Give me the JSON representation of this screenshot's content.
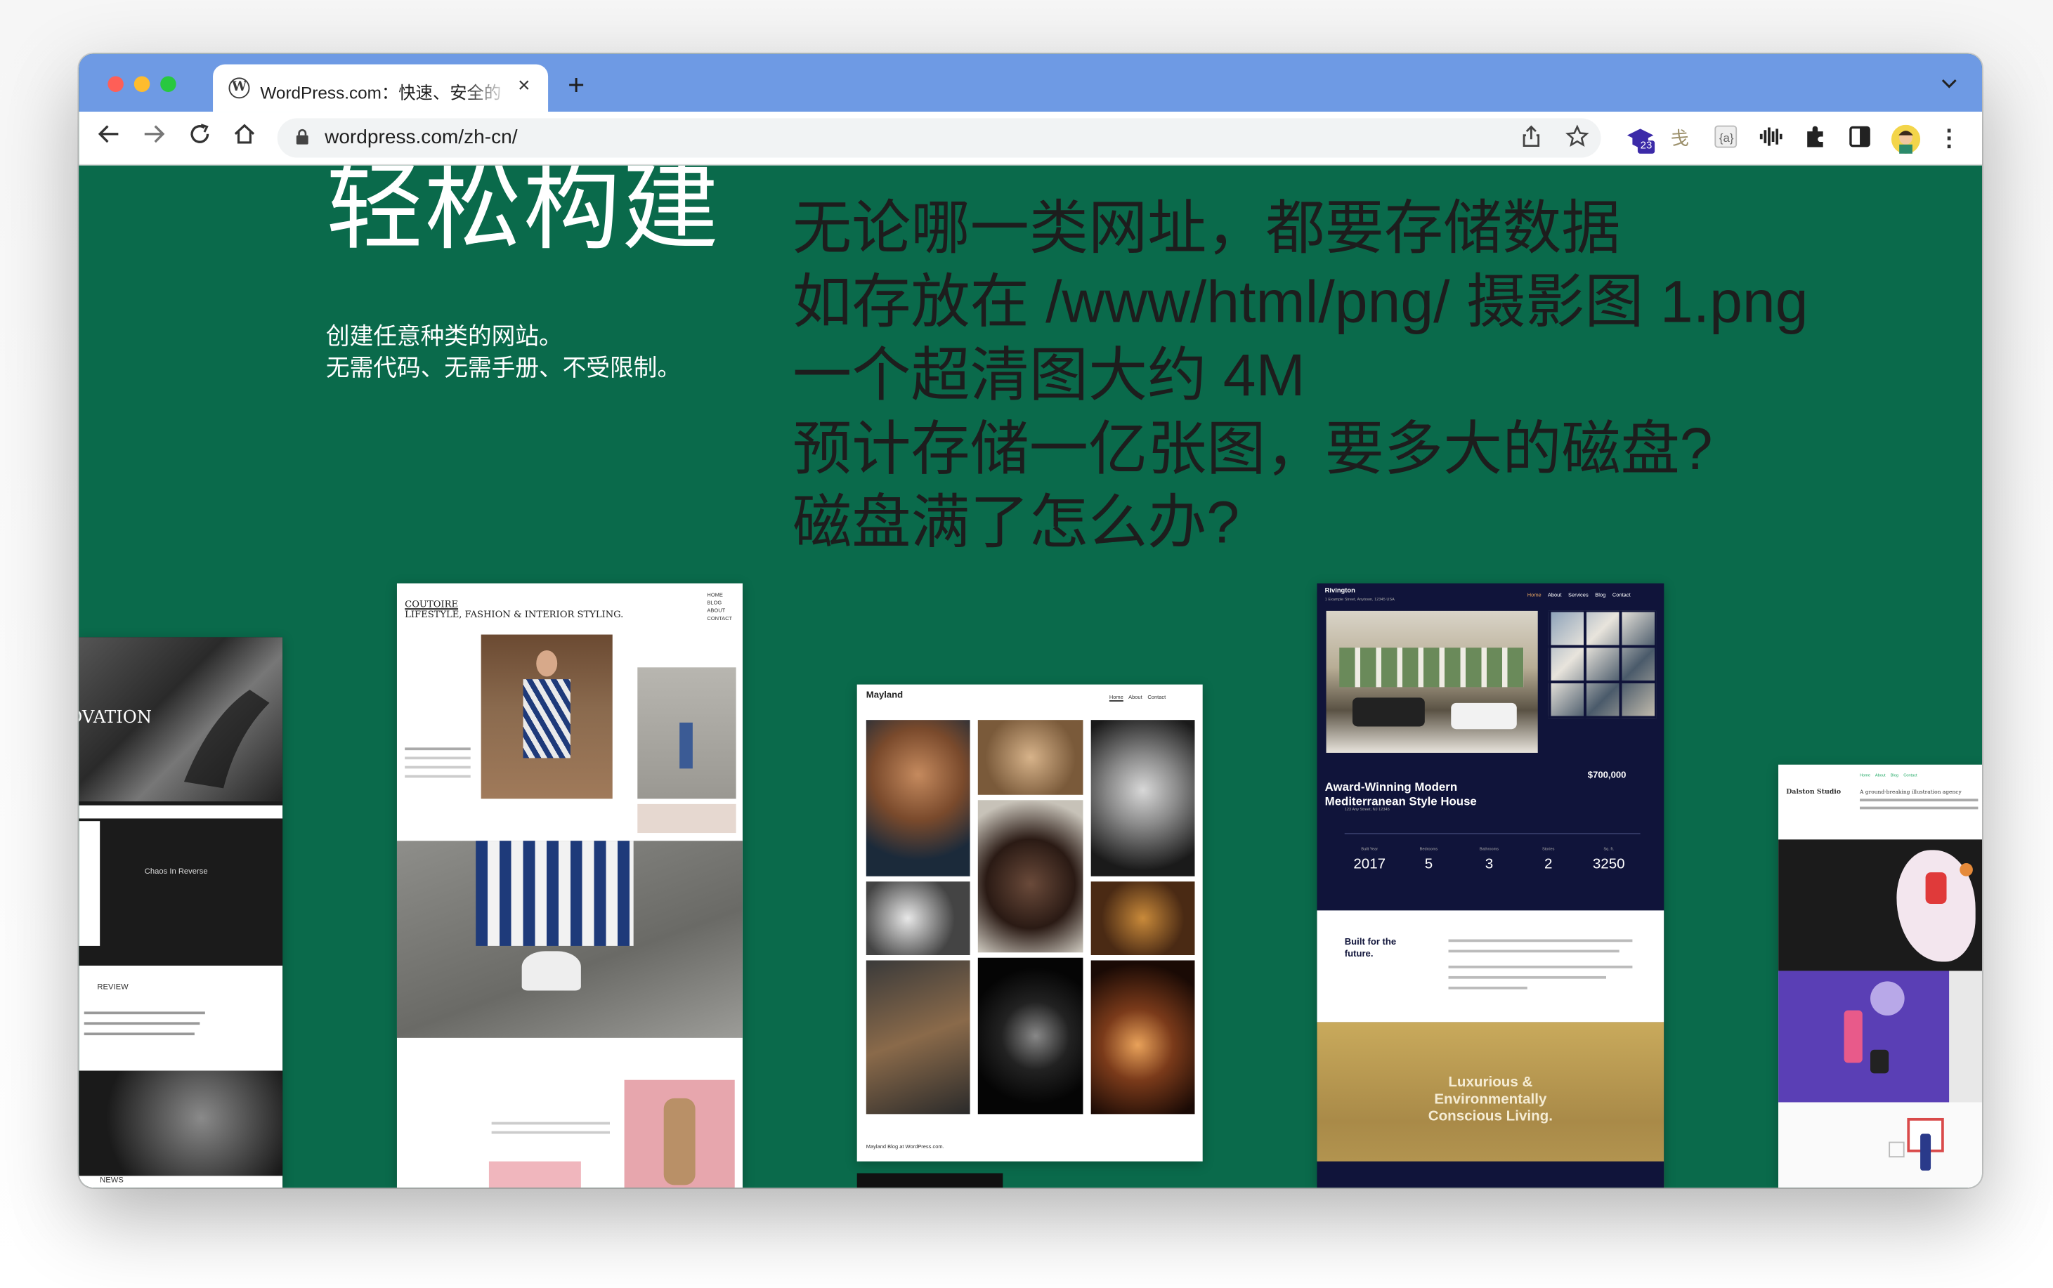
{
  "browser": {
    "tab": {
      "title": "WordPress.com：快速、安全的",
      "favicon": "wordpress-icon",
      "close": "×"
    },
    "new_tab": "+",
    "tab_menu": "⌄",
    "nav": {
      "back": "←",
      "forward": "→",
      "reload": "↻",
      "home": "⌂"
    },
    "address_bar": {
      "url": "wordpress.com/zh-cn/"
    },
    "extensions": {
      "badge_count": "23"
    },
    "menu": "⋮"
  },
  "page": {
    "headline": "轻松构建",
    "subline_1": "创建任意种类的网站。",
    "subline_2": "无需代码、无需手册、不受限制。"
  },
  "overlay_text": {
    "line_1": "无论哪一类网址，都要存储数据",
    "line_2": "如存放在 /www/html/png/ 摄影图 1.png",
    "line_3": "一个超清图大约 4M",
    "line_4": "预计存储一亿张图，要多大的磁盘?",
    "line_5": "磁盘满了怎么办?"
  },
  "showcase": {
    "innovation": {
      "title": "OVATION",
      "section": "Chaos In Reverse",
      "review": "REVIEW",
      "news": "NEWS"
    },
    "couture": {
      "brand": "COUTOIRE",
      "tagline": "LIFESTYLE, FASHION & INTERIOR STYLING.",
      "menu": [
        "HOME",
        "BLOG",
        "ABOUT",
        "CONTACT"
      ]
    },
    "mayland": {
      "brand": "Mayland",
      "menu": [
        "Home",
        "About",
        "Contact"
      ],
      "footer": "Mayland Blog at WordPress.com."
    },
    "rivington": {
      "brand": "Rivington",
      "address": "1 Example Street, Anytown, 12345 USA",
      "menu": [
        "Home",
        "About",
        "Services",
        "Blog",
        "Contact"
      ],
      "listing_title_1": "Award-Winning Modern",
      "listing_title_2": "Mediterranean Style House",
      "price": "$700,000",
      "address_2": "123 Any Street, NJ 12345",
      "stats": [
        {
          "label": "Built Year",
          "value": "2017"
        },
        {
          "label": "Bedrooms",
          "value": "5"
        },
        {
          "label": "Bathrooms",
          "value": "3"
        },
        {
          "label": "Stories",
          "value": "2"
        },
        {
          "label": "Sq. ft.",
          "value": "3250"
        }
      ],
      "built_for_1": "Built for the",
      "built_for_2": "future.",
      "promo_1": "Luxurious &",
      "promo_2": "Environmentally",
      "promo_3": "Conscious Living."
    },
    "dalston": {
      "brand": "Dalston Studio",
      "menu": [
        "Home",
        "About",
        "Blog",
        "Contact"
      ],
      "blurb": "A ground-breaking illustration agency"
    }
  }
}
